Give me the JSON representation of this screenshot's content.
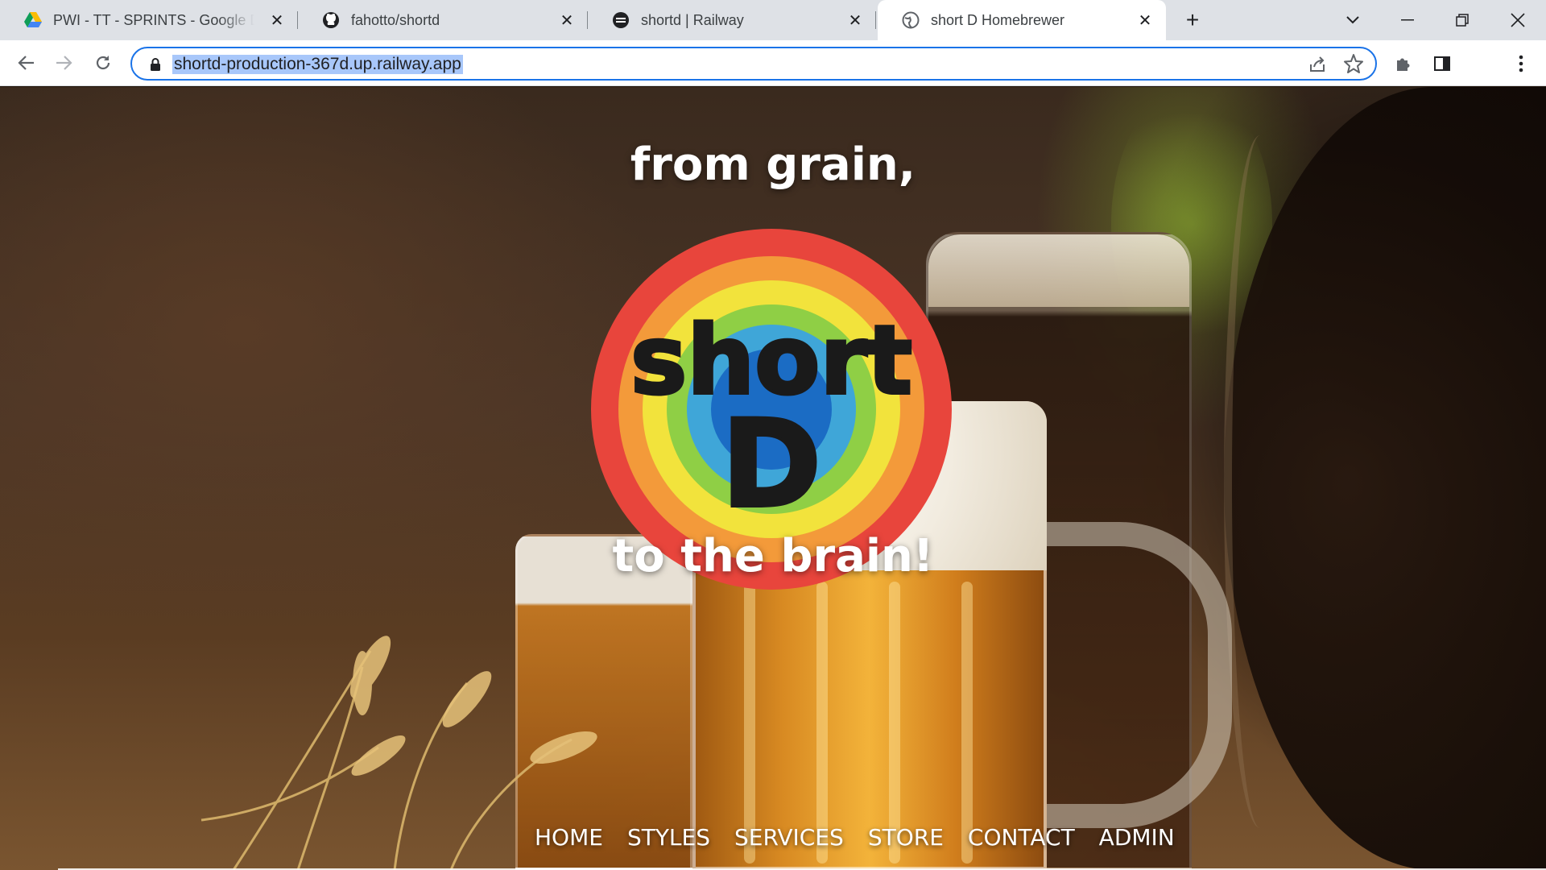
{
  "browser": {
    "tabs": [
      {
        "title": "PWI - TT - SPRINTS - Google Drive",
        "icon": "google-drive-icon",
        "active": false
      },
      {
        "title": "fahotto/shortd",
        "icon": "github-icon",
        "active": false
      },
      {
        "title": "shortd | Railway",
        "icon": "railway-icon",
        "active": false
      },
      {
        "title": "short D Homebrewer",
        "icon": "globe-icon",
        "active": true
      }
    ],
    "url": "shortd-production-367d.up.railway.app",
    "accent_color": "#1a73e8"
  },
  "page": {
    "hero": {
      "line_top": "from grain,",
      "line_bottom": "to the brain!",
      "logo_text_top": "short",
      "logo_text_bottom": "D"
    },
    "nav": [
      {
        "label": "HOME"
      },
      {
        "label": "STYLES"
      },
      {
        "label": "SERVICES"
      },
      {
        "label": "STORE"
      },
      {
        "label": "CONTACT"
      },
      {
        "label": "ADMIN"
      }
    ]
  }
}
